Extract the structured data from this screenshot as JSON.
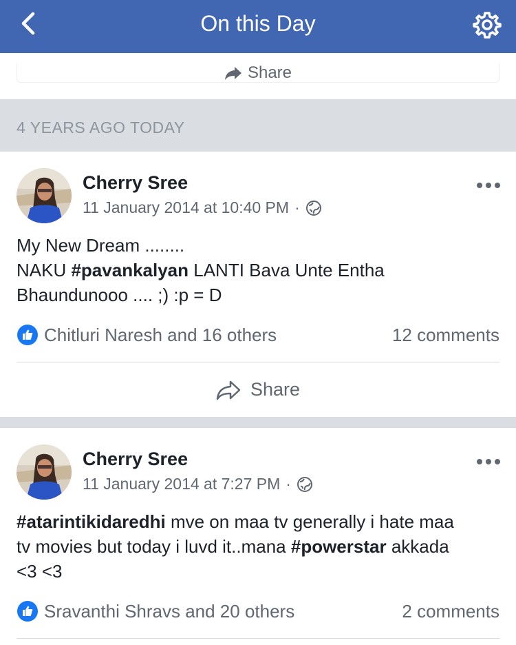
{
  "navbar": {
    "title": "On this Day",
    "back_icon": "chevron-left-icon",
    "settings_icon": "gear-icon",
    "color": "#4267b2"
  },
  "top_share": {
    "label": "Share"
  },
  "section": {
    "label": "4 YEARS AGO TODAY"
  },
  "posts": [
    {
      "author": "Cherry Sree",
      "timestamp": "11 January 2014 at 10:40 PM",
      "audience_icon": "globe-icon",
      "text_line1": "My New Dream ........",
      "text_line2_pre": "NAKU ",
      "text_line2_hashtag": "#pavankalyan",
      "text_line2_post": " LANTI Bava Unte Entha",
      "text_line3": "Bhaundunooo .... ;) :p = D",
      "reactions": "Chitluri Naresh and 16 others",
      "comments": "12 comments",
      "share_label": "Share"
    },
    {
      "author": "Cherry Sree",
      "timestamp": "11 January 2014 at 7:27 PM",
      "audience_icon": "globe-icon",
      "text_hashtag1": "#atarintikidaredhi",
      "text_part1": " mve on maa tv generally i hate maa",
      "text_part2": "tv movies but today i luvd it..mana ",
      "text_hashtag2": "#powerstar",
      "text_part3": " akkada",
      "text_line3": "<3 <3",
      "reactions": "Sravanthi Shravs and 20 others",
      "comments": "2 comments"
    }
  ]
}
